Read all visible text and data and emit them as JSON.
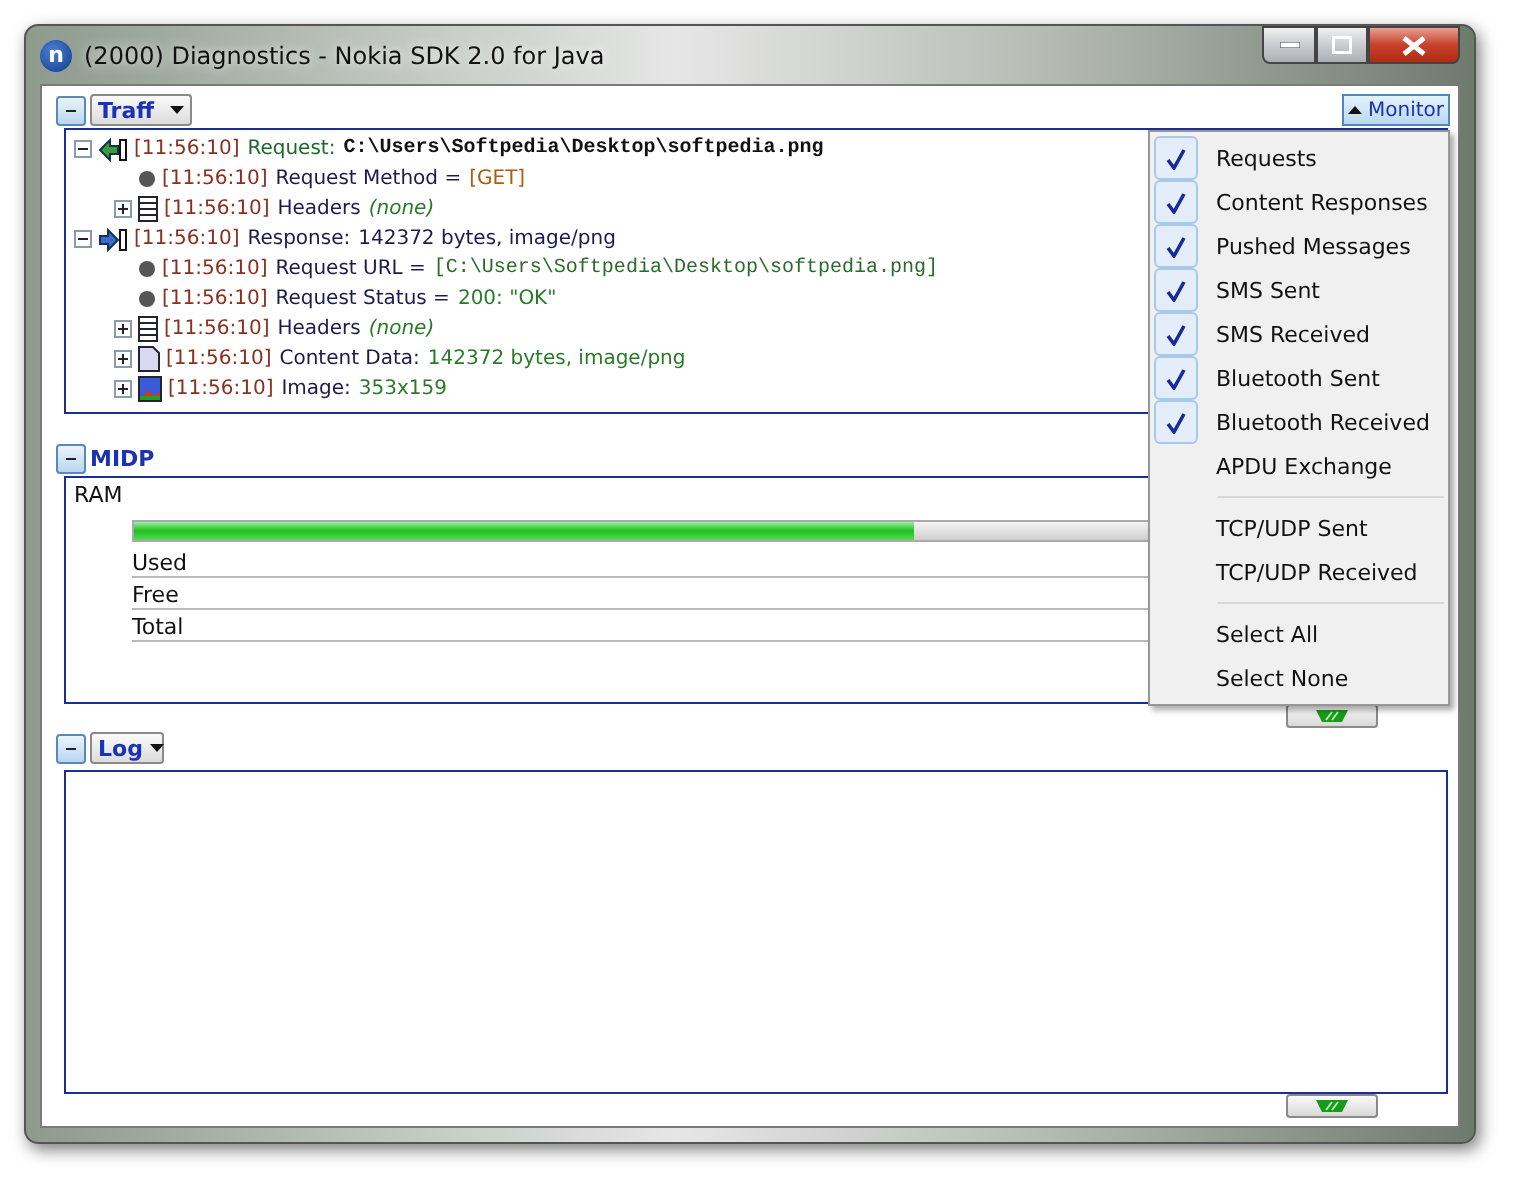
{
  "window": {
    "app_icon_letter": "n",
    "title": "(2000) Diagnostics - Nokia SDK 2.0 for Java"
  },
  "traffic": {
    "expanded": true,
    "filter": "Traff",
    "monitor_button": "Monitor",
    "monitor_open": true,
    "tree": [
      {
        "kind": "request",
        "expanded": true,
        "parts": [
          {
            "kind": "time",
            "text": "[11:56:10]"
          },
          {
            "kind": "label_green",
            "text": "Request:"
          },
          {
            "kind": "code",
            "text": "C:\\Users\\Softpedia\\Desktop\\softpedia.png"
          }
        ],
        "children": [
          {
            "kind": "property",
            "parts": [
              {
                "kind": "time",
                "text": "[11:56:10]"
              },
              {
                "kind": "label",
                "text": "Request Method ="
              },
              {
                "kind": "bracket",
                "text": "[GET]"
              }
            ]
          },
          {
            "kind": "headers",
            "expanded": false,
            "parts": [
              {
                "kind": "time",
                "text": "[11:56:10]"
              },
              {
                "kind": "label",
                "text": "Headers"
              },
              {
                "kind": "note",
                "text": "(none)"
              }
            ]
          }
        ]
      },
      {
        "kind": "response",
        "expanded": true,
        "parts": [
          {
            "kind": "time",
            "text": "[11:56:10]"
          },
          {
            "kind": "label",
            "text": "Response:"
          },
          {
            "kind": "label",
            "text": "142372 bytes, image/png"
          }
        ],
        "children": [
          {
            "kind": "property",
            "parts": [
              {
                "kind": "time",
                "text": "[11:56:10]"
              },
              {
                "kind": "label",
                "text": "Request URL ="
              },
              {
                "kind": "code_link",
                "text": "[C:\\Users\\Softpedia\\Desktop\\softpedia.png]"
              }
            ]
          },
          {
            "kind": "property",
            "parts": [
              {
                "kind": "time",
                "text": "[11:56:10]"
              },
              {
                "kind": "label",
                "text": "Request Status ="
              },
              {
                "kind": "value",
                "text": "200: \"OK\""
              }
            ]
          },
          {
            "kind": "headers",
            "expanded": false,
            "parts": [
              {
                "kind": "time",
                "text": "[11:56:10]"
              },
              {
                "kind": "label",
                "text": "Headers"
              },
              {
                "kind": "note",
                "text": "(none)"
              }
            ]
          },
          {
            "kind": "content",
            "expanded": false,
            "parts": [
              {
                "kind": "time",
                "text": "[11:56:10]"
              },
              {
                "kind": "label",
                "text": "Content Data:"
              },
              {
                "kind": "value",
                "text": "142372 bytes, image/png"
              }
            ]
          },
          {
            "kind": "image",
            "expanded": false,
            "parts": [
              {
                "kind": "time",
                "text": "[11:56:10]"
              },
              {
                "kind": "label",
                "text": "Image:"
              },
              {
                "kind": "value",
                "text": "353x159"
              }
            ]
          }
        ]
      }
    ]
  },
  "midp": {
    "expanded": true,
    "title": "MIDP",
    "ram_label": "RAM",
    "ram": {
      "level": 0.6
    },
    "rows": [
      "Used",
      "Free",
      "Total"
    ]
  },
  "log": {
    "expanded": true,
    "filter": "Log"
  },
  "monitor_menu": {
    "groups": [
      [
        {
          "label": "Requests",
          "checked": true
        },
        {
          "label": "Content Responses",
          "checked": true
        },
        {
          "label": "Pushed Messages",
          "checked": true
        },
        {
          "label": "SMS Sent",
          "checked": true
        },
        {
          "label": "SMS Received",
          "checked": true
        },
        {
          "label": "Bluetooth Sent",
          "checked": true
        },
        {
          "label": "Bluetooth Received",
          "checked": true
        },
        {
          "label": "APDU Exchange",
          "checked": false
        }
      ],
      [
        {
          "label": "TCP/UDP Sent",
          "checked": false
        },
        {
          "label": "TCP/UDP Received",
          "checked": false
        }
      ],
      [
        {
          "label": "Select All",
          "checked": false
        },
        {
          "label": "Select None",
          "checked": false
        }
      ]
    ]
  }
}
